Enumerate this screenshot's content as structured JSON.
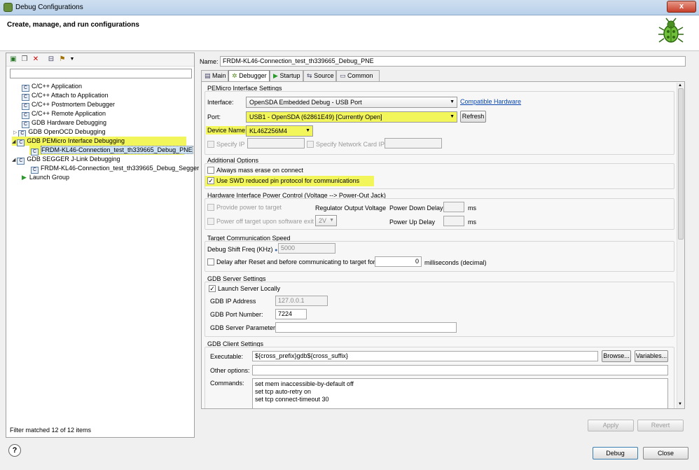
{
  "window": {
    "title": "Debug Configurations",
    "close": "x"
  },
  "header": {
    "title": "Create, manage, and run configurations"
  },
  "left": {
    "toolbar": [
      "new-config",
      "duplicate",
      "delete",
      "collapse-all",
      "filter"
    ],
    "tree": [
      {
        "label": "C/C++ Application"
      },
      {
        "label": "C/C++ Attach to Application"
      },
      {
        "label": "C/C++ Postmortem Debugger"
      },
      {
        "label": "C/C++ Remote Application"
      },
      {
        "label": "GDB Hardware Debugging"
      },
      {
        "label": "GDB OpenOCD Debugging"
      },
      {
        "label": "GDB PEMicro Interface Debugging"
      },
      {
        "label": "FRDM-KL46-Connection_test_th339665_Debug_PNE"
      },
      {
        "label": "GDB SEGGER J-Link Debugging"
      },
      {
        "label": "FRDM-KL46-Connection_test_th339665_Debug_Segger"
      },
      {
        "label": "Launch Group"
      }
    ],
    "filter_status": "Filter matched 12 of 12 items"
  },
  "right": {
    "name_label": "Name:",
    "name_value": "FRDM-KL46-Connection_test_th339665_Debug_PNE",
    "tabs": [
      "Main",
      "Debugger",
      "Startup",
      "Source",
      "Common"
    ],
    "pemicro": {
      "title": "PEMicro Interface Settings",
      "interface_label": "Interface:",
      "interface_value": "OpenSDA Embedded Debug - USB Port",
      "compat_link": "Compatible Hardware",
      "port_label": "Port:",
      "port_value": "USB1 - OpenSDA (62861E49) [Currently Open]",
      "refresh": "Refresh",
      "device_label": "Device Name:",
      "device_value": "KL46Z256M4",
      "specify_ip": "Specify IP",
      "specify_netcard": "Specify Network Card IP"
    },
    "additional": {
      "title": "Additional Options",
      "mass_erase": "Always mass erase on connect",
      "swd_reduced": "Use SWD reduced pin protocol for communications"
    },
    "power": {
      "title": "Hardware Interface Power Control (Voltage --> Power-Out Jack)",
      "provide_power": "Provide power to target",
      "regulator": "Regulator Output Voltage",
      "power_down": "Power Down Delay",
      "ms1": "ms",
      "power_off": "Power off target upon software exit",
      "voltage": "2V",
      "power_up": "Power Up Delay",
      "ms2": "ms"
    },
    "comm": {
      "title": "Target Communication Speed",
      "shift_label": "Debug Shift Freq (KHz)",
      "shift_value": "5000",
      "delay_label": "Delay after Reset and before communicating to target for",
      "delay_value": "0",
      "delay_unit": "milliseconds (decimal)"
    },
    "gdbserver": {
      "title": "GDB Server Settings",
      "launch_local": "Launch Server Locally",
      "ip_label": "GDB IP Address",
      "ip_value": "127.0.0.1",
      "port_label": "GDB Port Number:",
      "port_value": "7224",
      "params_label": "GDB Server Parameters:"
    },
    "gdbclient": {
      "title": "GDB Client Settings",
      "exec_label": "Executable:",
      "exec_value": "${cross_prefix}gdb${cross_suffix}",
      "browse": "Browse...",
      "variables": "Variables...",
      "other_label": "Other options:",
      "commands_label": "Commands:",
      "commands": [
        "set mem inaccessible-by-default off",
        "set tcp auto-retry on",
        "set tcp connect-timeout 30"
      ]
    },
    "apply": "Apply",
    "revert": "Revert"
  },
  "footer": {
    "help": "?",
    "debug": "Debug",
    "close": "Close"
  }
}
